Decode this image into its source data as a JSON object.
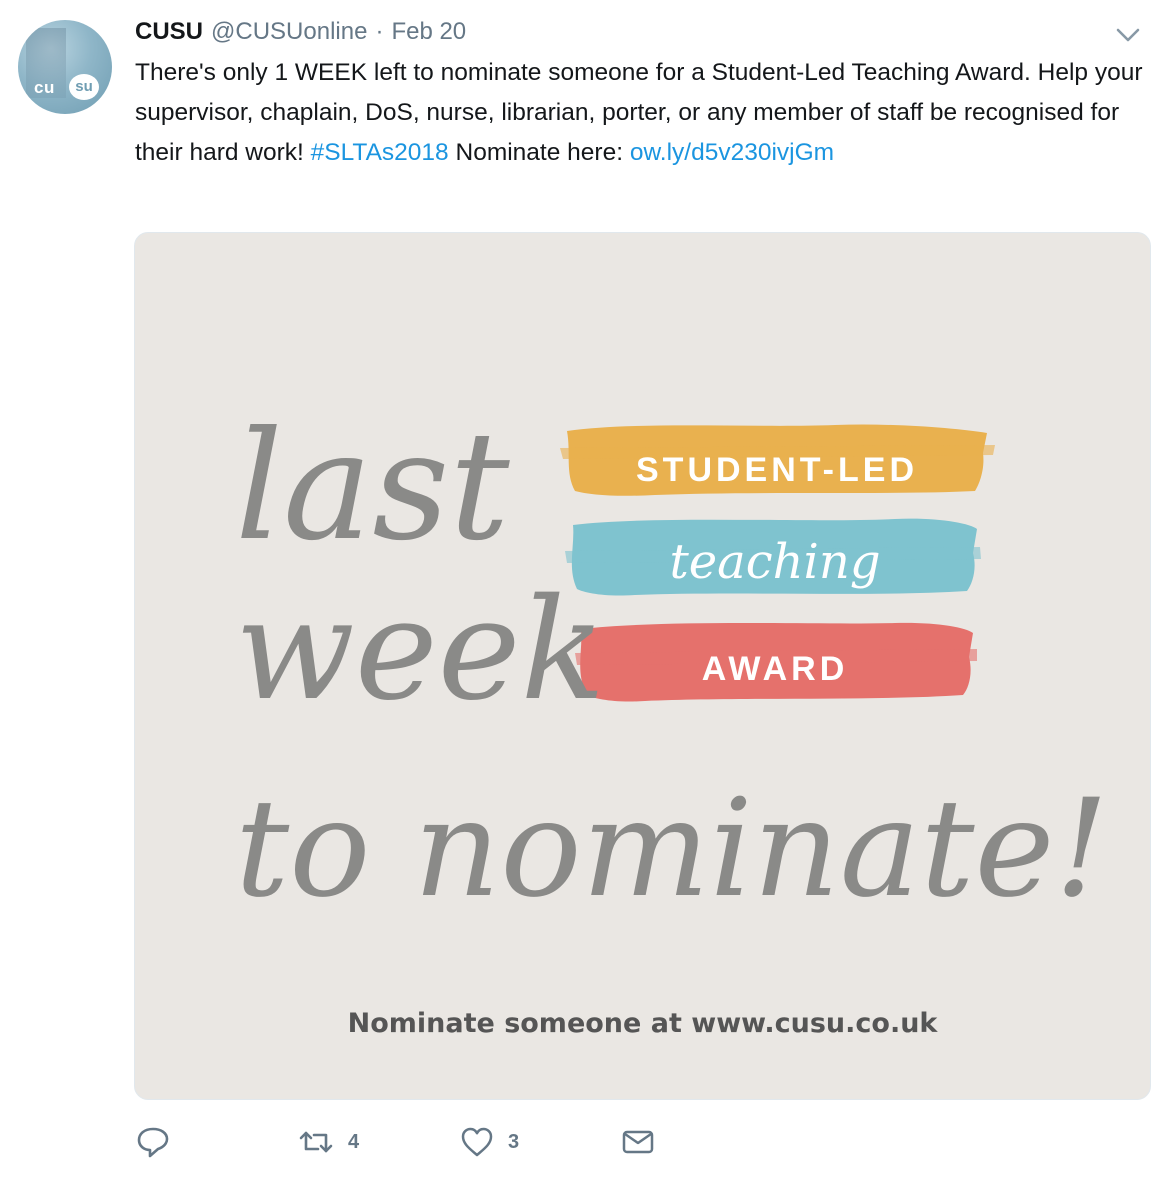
{
  "tweet": {
    "name": "CUSU",
    "handle": "@CUSUonline",
    "separator": "·",
    "date": "Feb 20",
    "avatar": {
      "logo_left": "cu",
      "logo_right": "su"
    },
    "text_plain": "There's only 1 WEEK left to nominate someone for a Student-Led Teaching Award. Help your supervisor, chaplain, DoS, nurse, librarian, porter, or any member of staff be recognised for their hard work! ",
    "hashtag": "#SLTAs2018",
    "text_after_hashtag": " Nominate here: ",
    "link": "ow.ly/d5v230ivjGm"
  },
  "media": {
    "script_line1": "last",
    "script_line2": "week",
    "script_line3": "to nominate!",
    "band1": "STUDENT-LED",
    "band2": "teaching",
    "band3": "AWARD",
    "cta": "Nominate someone at www.cusu.co.uk",
    "colors": {
      "band1": "#e9b14f",
      "band2": "#7fc3cf",
      "band3": "#e5716c",
      "background": "#eae7e3",
      "script": "#8a8a88"
    }
  },
  "actions": {
    "reply_icon": "reply-icon",
    "retweet_icon": "retweet-icon",
    "retweet_count": "4",
    "like_icon": "heart-icon",
    "like_count": "3",
    "dm_icon": "envelope-icon"
  },
  "colors": {
    "link": "#1b95e0",
    "muted": "#657786",
    "text": "#14171a"
  }
}
